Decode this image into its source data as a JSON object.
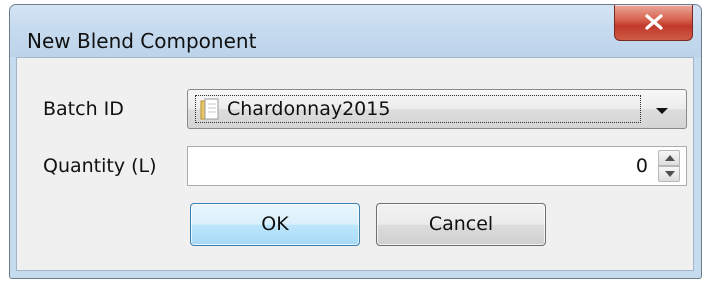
{
  "window": {
    "title": "New Blend Component",
    "close_glyph": "close-icon"
  },
  "form": {
    "batch_label": "Batch ID",
    "batch_value": "Chardonnay2015",
    "batch_icon": "document-folder-icon",
    "quantity_label": "Quantity (L)",
    "quantity_value": "0"
  },
  "buttons": {
    "ok_label": "OK",
    "cancel_label": "Cancel"
  },
  "colors": {
    "titlebar": "#c7dbef",
    "close_button": "#c9442f",
    "default_button": "#bee6fd"
  }
}
